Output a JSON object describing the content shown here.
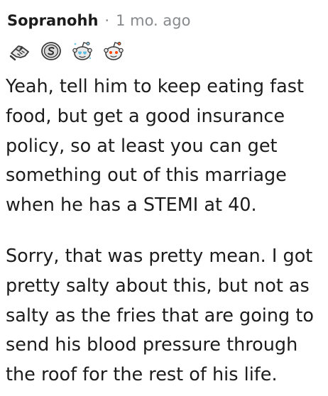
{
  "comment": {
    "author": "Sopranohh",
    "separator": "·",
    "timestamp": "1 mo. ago",
    "awards": [
      {
        "icon": "handshake-award-icon"
      },
      {
        "icon": "coin-award-icon"
      },
      {
        "icon": "snoo-heart-eyes-award-icon"
      },
      {
        "icon": "snoo-award-icon"
      }
    ],
    "body": [
      "Yeah, tell him to keep eating fast food, but get a good insurance policy, so at least you can get something out of this marriage when he has a STEMI at 40.",
      "Sorry, that was pretty mean. I got pretty salty about this, but not as salty as the fries that are going to send his blood pressure through the roof for the rest of his life."
    ]
  }
}
